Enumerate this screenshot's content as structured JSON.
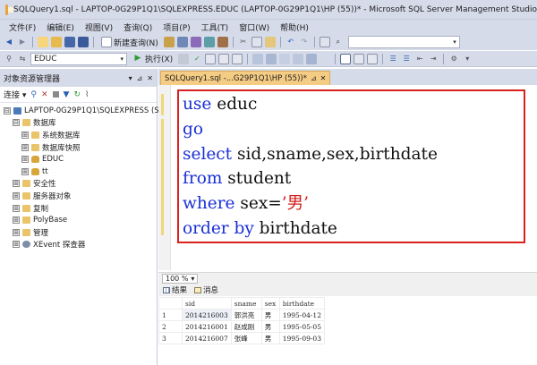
{
  "window": {
    "title": "SQLQuery1.sql - LAPTOP-0G29P1Q1\\SQLEXPRESS.EDUC (LAPTOP-0G29P1Q1\\HP (55))* - Microsoft SQL Server Management Studio"
  },
  "menu": [
    "文件(F)",
    "编辑(E)",
    "视图(V)",
    "查询(Q)",
    "项目(P)",
    "工具(T)",
    "窗口(W)",
    "帮助(H)"
  ],
  "toolbar1": {
    "new_query_label": "新建查询(N)"
  },
  "toolbar2": {
    "database": "EDUC",
    "execute_label": "执行(X)"
  },
  "object_explorer": {
    "title": "对象资源管理器",
    "connect_label": "连接",
    "tree": [
      {
        "label": "LAPTOP-0G29P1Q1\\SQLEXPRESS (SQL",
        "expander": "⊟",
        "icon": "server-icon"
      },
      {
        "label": "数据库",
        "expander": "⊟",
        "icon": "folder-icon"
      },
      {
        "label": "系统数据库",
        "expander": "⊞",
        "icon": "folder-icon"
      },
      {
        "label": "数据库快照",
        "expander": "⊞",
        "icon": "folder-icon"
      },
      {
        "label": "EDUC",
        "expander": "⊞",
        "icon": "database-icon"
      },
      {
        "label": "tt",
        "expander": "⊞",
        "icon": "database-icon"
      },
      {
        "label": "安全性",
        "expander": "⊞",
        "icon": "folder-icon"
      },
      {
        "label": "服务器对象",
        "expander": "⊞",
        "icon": "folder-icon"
      },
      {
        "label": "复制",
        "expander": "⊞",
        "icon": "folder-icon"
      },
      {
        "label": "PolyBase",
        "expander": "⊞",
        "icon": "folder-icon"
      },
      {
        "label": "管理",
        "expander": "⊞",
        "icon": "folder-icon"
      },
      {
        "label": "XEvent 探查器",
        "expander": "⊞",
        "icon": "xevent-icon"
      }
    ]
  },
  "editor": {
    "tab_label": "SQLQuery1.sql -...G29P1Q1\\HP (55))*",
    "code": {
      "l1_kw": "use",
      "l1_rest": " educ",
      "l2_kw": "go",
      "l3_kw": "select",
      "l3_rest": " sid,sname,sex,birthdate",
      "l4_kw": "from",
      "l4_rest": " student",
      "l5_kw": "where",
      "l5_mid": " sex=",
      "l5_str": "’男’",
      "l6_kw": "order by",
      "l6_rest": " birthdate"
    },
    "zoom": "100 %"
  },
  "results": {
    "tab_results": "结果",
    "tab_messages": "消息",
    "columns": [
      "sid",
      "sname",
      "sex",
      "birthdate"
    ],
    "rows": [
      {
        "num": "1",
        "sid": "2014216003",
        "sname": "郭洪亮",
        "sex": "男",
        "birthdate": "1995-04-12"
      },
      {
        "num": "2",
        "sid": "2014216001",
        "sname": "赵成刚",
        "sex": "男",
        "birthdate": "1995-05-05"
      },
      {
        "num": "3",
        "sid": "2014216007",
        "sname": "张峰",
        "sex": "男",
        "birthdate": "1995-09-03"
      }
    ]
  }
}
